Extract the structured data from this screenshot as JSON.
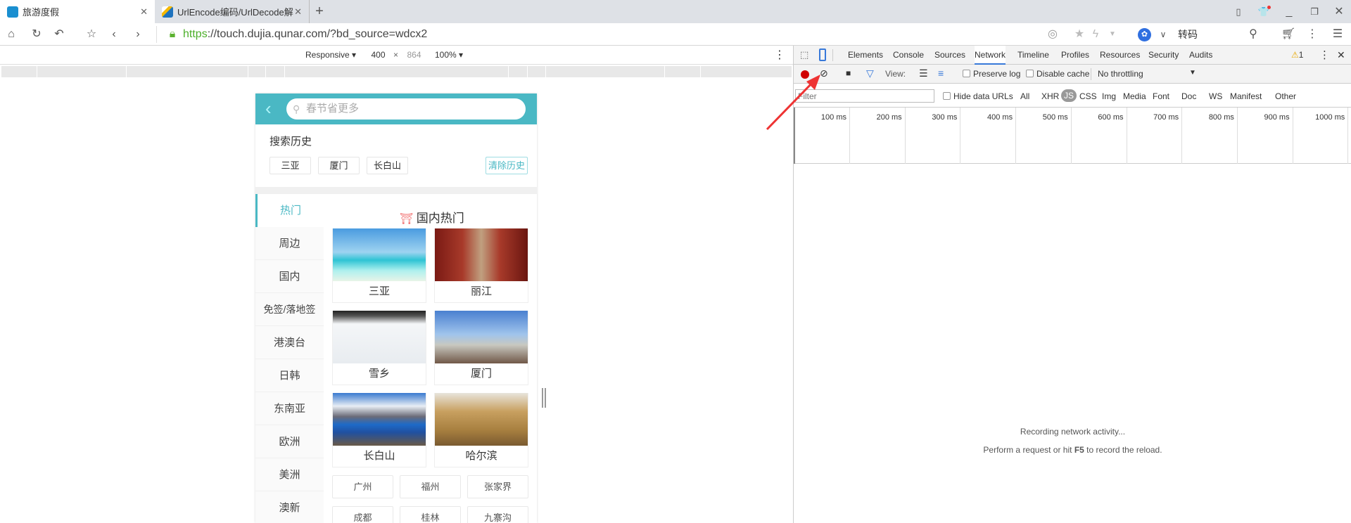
{
  "browser": {
    "tabs": [
      {
        "title": "旅游度假",
        "active": true
      },
      {
        "title": "UrlEncode编码/UrlDecode解"
      }
    ],
    "url_scheme": "https",
    "url_rest": "://touch.dujia.qunar.com/?bd_source=wdcx2",
    "transcode_label": "转码"
  },
  "device_toolbar": {
    "mode": "Responsive",
    "width": "400",
    "height": "864",
    "zoom": "100%"
  },
  "page": {
    "search_placeholder": "春节省更多",
    "history_title": "搜索历史",
    "history": [
      "三亚",
      "厦门",
      "长白山"
    ],
    "clear_history": "清除历史",
    "sidebar": [
      "热门",
      "周边",
      "国内",
      "免签/落地签",
      "港澳台",
      "日韩",
      "东南亚",
      "欧洲",
      "美洲",
      "澳新"
    ],
    "section_title": "国内热门",
    "cards": [
      "三亚",
      "丽江",
      "雪乡",
      "厦门",
      "长白山",
      "哈尔滨"
    ],
    "city_chips": [
      "广州",
      "福州",
      "张家界",
      "成都",
      "桂林",
      "九寨沟"
    ]
  },
  "devtools": {
    "tabs": [
      "Elements",
      "Console",
      "Sources",
      "Network",
      "Timeline",
      "Profiles",
      "Resources",
      "Security",
      "Audits"
    ],
    "active_tab": "Network",
    "warning_count": "1",
    "view_label": "View:",
    "preserve_log": "Preserve log",
    "disable_cache": "Disable cache",
    "throttling": "No throttling",
    "filter_placeholder": "Filter",
    "hide_data_urls": "Hide data URLs",
    "filter_types": [
      "All",
      "XHR",
      "JS",
      "CSS",
      "Img",
      "Media",
      "Font",
      "Doc",
      "WS",
      "Manifest",
      "Other"
    ],
    "timeline_ticks": [
      "100 ms",
      "200 ms",
      "300 ms",
      "400 ms",
      "500 ms",
      "600 ms",
      "700 ms",
      "800 ms",
      "900 ms",
      "1000 ms"
    ],
    "recording_msg": "Recording network activity...",
    "hint_pre": "Perform a request or hit ",
    "hint_key": "F5",
    "hint_post": " to record the reload."
  },
  "colors": {
    "accent": "#4ab8c4",
    "record": "#d00000",
    "arrow": "#ee3333",
    "network_tab": "#3879d9"
  }
}
